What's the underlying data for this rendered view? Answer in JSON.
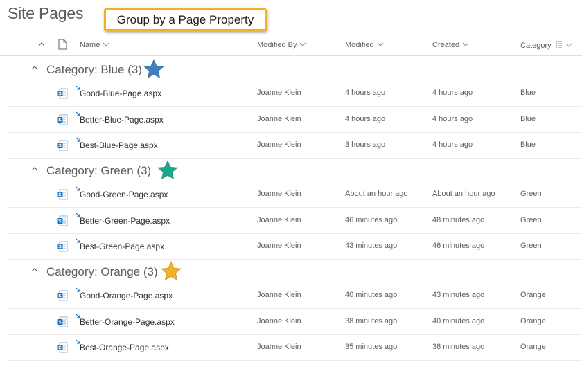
{
  "page_title": "Site Pages",
  "callout": "Group by a Page Property",
  "columns": {
    "name": "Name",
    "modified_by": "Modified By",
    "modified": "Modified",
    "created": "Created",
    "category": "Category"
  },
  "groups": [
    {
      "label": "Category: Blue",
      "count": "(3)",
      "star_color": "#3f7fc0",
      "rows": [
        {
          "name": "Good-Blue-Page.aspx",
          "modified_by": "Joanne Klein",
          "modified": "4 hours ago",
          "created": "4 hours ago",
          "category": "Blue"
        },
        {
          "name": "Better-Blue-Page.aspx",
          "modified_by": "Joanne Klein",
          "modified": "4 hours ago",
          "created": "4 hours ago",
          "category": "Blue"
        },
        {
          "name": "Best-Blue-Page.aspx",
          "modified_by": "Joanne Klein",
          "modified": "3 hours ago",
          "created": "4 hours ago",
          "category": "Blue"
        }
      ]
    },
    {
      "label": "Category: Green",
      "count": "(3)",
      "star_color": "#19a88a",
      "rows": [
        {
          "name": "Good-Green-Page.aspx",
          "modified_by": "Joanne Klein",
          "modified": "About an hour ago",
          "created": "About an hour ago",
          "category": "Green"
        },
        {
          "name": "Better-Green-Page.aspx",
          "modified_by": "Joanne Klein",
          "modified": "46 minutes ago",
          "created": "48 minutes ago",
          "category": "Green"
        },
        {
          "name": "Best-Green-Page.aspx",
          "modified_by": "Joanne Klein",
          "modified": "43 minutes ago",
          "created": "46 minutes ago",
          "category": "Green"
        }
      ]
    },
    {
      "label": "Category: Orange",
      "count": "(3)",
      "star_color": "#f3b21f",
      "rows": [
        {
          "name": "Good-Orange-Page.aspx",
          "modified_by": "Joanne Klein",
          "modified": "40 minutes ago",
          "created": "43 minutes ago",
          "category": "Orange"
        },
        {
          "name": "Better-Orange-Page.aspx",
          "modified_by": "Joanne Klein",
          "modified": "38 minutes ago",
          "created": "40 minutes ago",
          "category": "Orange"
        },
        {
          "name": "Best-Orange-Page.aspx",
          "modified_by": "Joanne Klein",
          "modified": "35 minutes ago",
          "created": "38 minutes ago",
          "category": "Orange"
        }
      ]
    }
  ]
}
